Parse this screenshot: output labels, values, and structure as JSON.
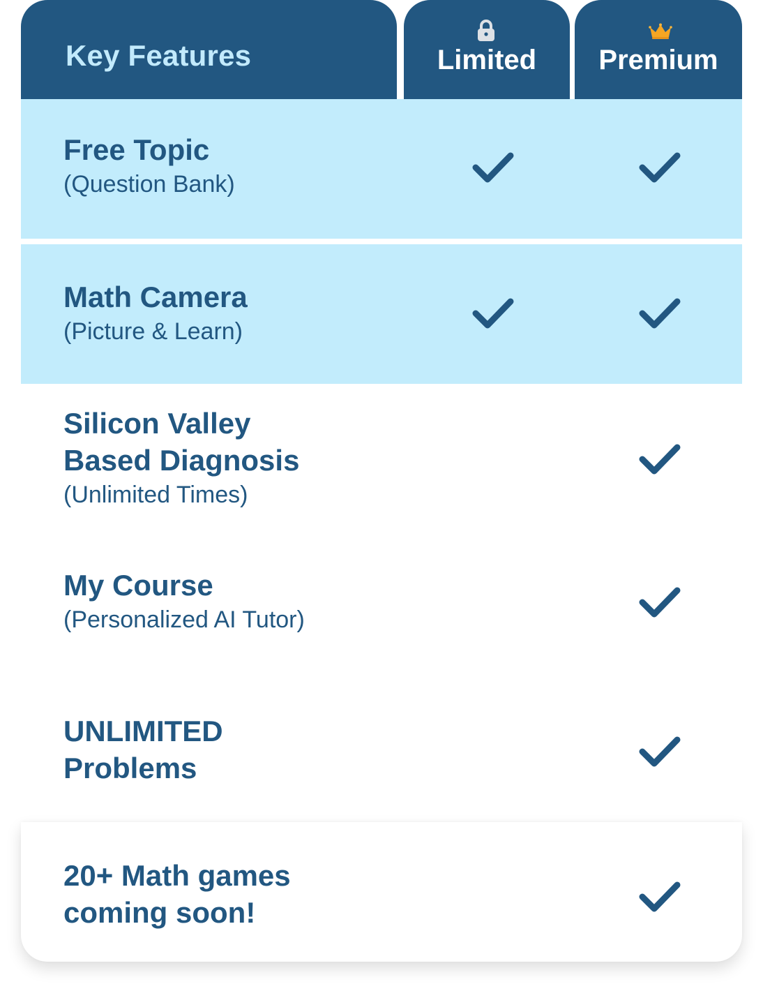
{
  "header": {
    "title": "Key Features",
    "plans": [
      {
        "label": "Limited",
        "icon": "lock-icon"
      },
      {
        "label": "Premium",
        "icon": "crown-icon"
      }
    ]
  },
  "colors": {
    "header_bg": "#225781",
    "header_title": "#c2eafc",
    "highlight_row": "#c2ecfc",
    "text": "#225781",
    "check": "#225781",
    "lock": "#dde1e6",
    "crown": "#f5a623"
  },
  "features": [
    {
      "title": "Free Topic",
      "subtitle": "(Question Bank)",
      "limited": true,
      "premium": true,
      "highlighted": true
    },
    {
      "title": "Math Camera",
      "subtitle": "(Picture & Learn)",
      "limited": true,
      "premium": true,
      "highlighted": true
    },
    {
      "title": "Silicon Valley\nBased Diagnosis",
      "subtitle": "(Unlimited Times)",
      "limited": false,
      "premium": true,
      "highlighted": false
    },
    {
      "title": "My Course",
      "subtitle": "(Personalized AI Tutor)",
      "limited": false,
      "premium": true,
      "highlighted": false
    },
    {
      "title": "UNLIMITED\nProblems",
      "subtitle": "",
      "limited": false,
      "premium": true,
      "highlighted": false
    },
    {
      "title": "20+ Math games\ncoming soon!",
      "subtitle": "",
      "limited": false,
      "premium": true,
      "highlighted": false
    }
  ]
}
